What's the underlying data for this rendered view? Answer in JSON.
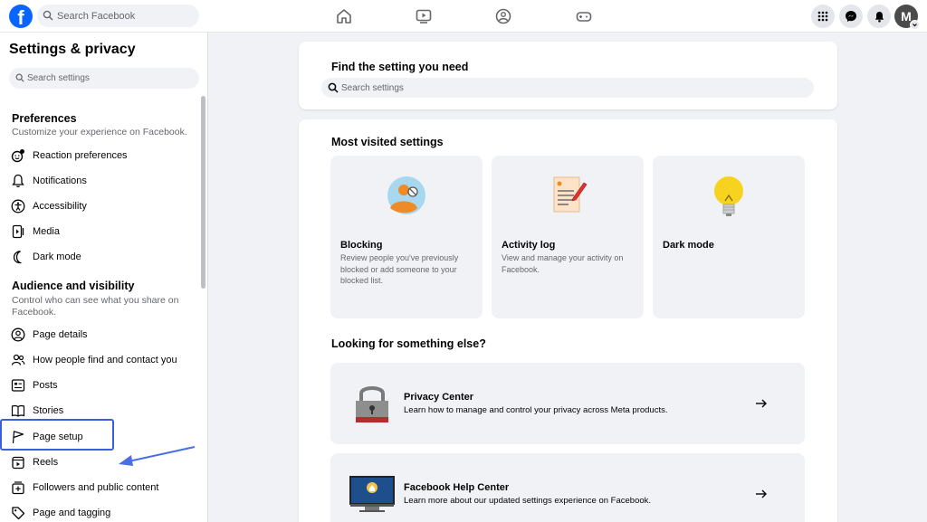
{
  "topbar": {
    "logo_letter": "f",
    "search_placeholder": "Search Facebook",
    "avatar_letter": "M"
  },
  "sidebar": {
    "title": "Settings & privacy",
    "search_placeholder": "Search settings",
    "preferences": {
      "title": "Preferences",
      "description": "Customize your experience on Facebook.",
      "items": [
        {
          "label": "Reaction preferences",
          "icon": "reaction-icon"
        },
        {
          "label": "Notifications",
          "icon": "bell-icon"
        },
        {
          "label": "Accessibility",
          "icon": "accessibility-icon"
        },
        {
          "label": "Media",
          "icon": "media-icon"
        },
        {
          "label": "Dark mode",
          "icon": "moon-icon"
        }
      ]
    },
    "audience": {
      "title": "Audience and visibility",
      "description": "Control who can see what you share on Facebook.",
      "items": [
        {
          "label": "Page details",
          "icon": "person-circle-icon"
        },
        {
          "label": "How people find and contact you",
          "icon": "people-icon"
        },
        {
          "label": "Posts",
          "icon": "posts-icon"
        },
        {
          "label": "Stories",
          "icon": "book-icon"
        },
        {
          "label": "Page setup",
          "icon": "flag-icon"
        },
        {
          "label": "Reels",
          "icon": "reels-icon"
        },
        {
          "label": "Followers and public content",
          "icon": "followers-icon"
        },
        {
          "label": "Page and tagging",
          "icon": "tag-icon"
        }
      ]
    }
  },
  "main": {
    "find_title": "Find the setting you need",
    "search_placeholder": "Search settings",
    "most_visited_title": "Most visited settings",
    "tiles": [
      {
        "title": "Blocking",
        "description": "Review people you've previously blocked or add someone to your blocked list."
      },
      {
        "title": "Activity log",
        "description": "View and manage your activity on Facebook."
      },
      {
        "title": "Dark mode",
        "description": ""
      }
    ],
    "looking_title": "Looking for something else?",
    "rows": [
      {
        "title": "Privacy Center",
        "description": "Learn how to manage and control your privacy across Meta products."
      },
      {
        "title": "Facebook Help Center",
        "description": "Learn more about our updated settings experience on Facebook."
      }
    ]
  },
  "colors": {
    "brand": "#0866ff",
    "highlight": "#3b5fdc"
  }
}
